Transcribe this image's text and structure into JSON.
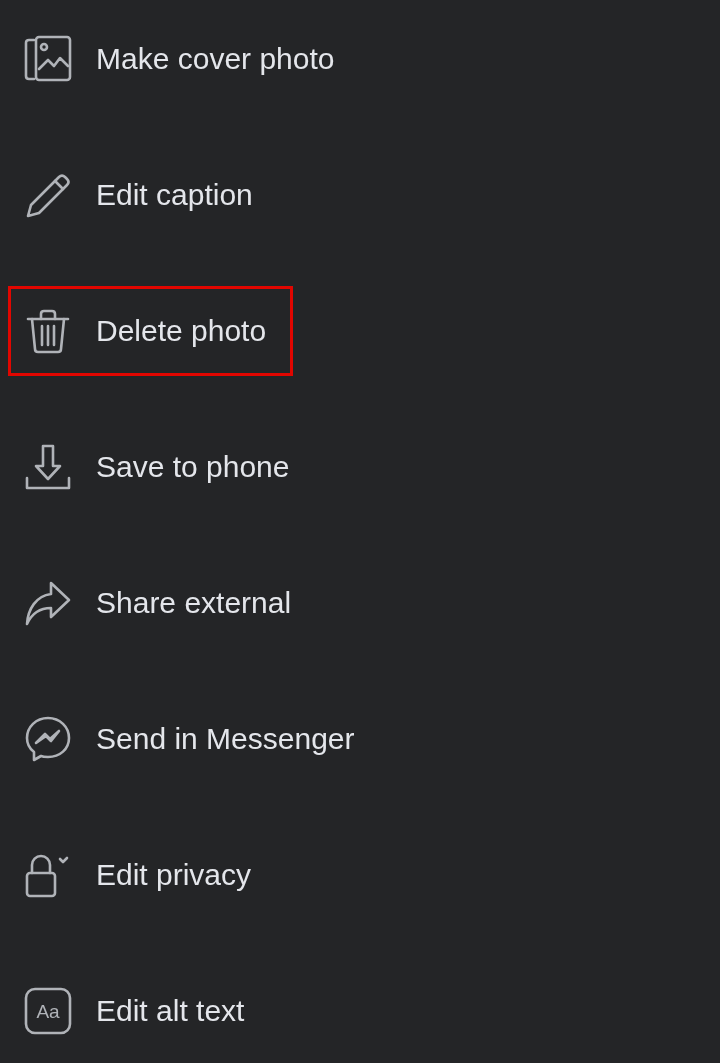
{
  "menu": {
    "items": [
      {
        "kind": "cover-photo",
        "label": "Make cover photo",
        "highlighted": false
      },
      {
        "kind": "edit",
        "label": "Edit caption",
        "highlighted": false
      },
      {
        "kind": "delete",
        "label": "Delete photo",
        "highlighted": true
      },
      {
        "kind": "save",
        "label": "Save to phone",
        "highlighted": false
      },
      {
        "kind": "share",
        "label": "Share external",
        "highlighted": false
      },
      {
        "kind": "messenger",
        "label": "Send in Messenger",
        "highlighted": false
      },
      {
        "kind": "privacy",
        "label": "Edit privacy",
        "highlighted": false
      },
      {
        "kind": "alt-text",
        "label": "Edit alt text",
        "highlighted": false,
        "icon_text": "Aa"
      }
    ]
  }
}
